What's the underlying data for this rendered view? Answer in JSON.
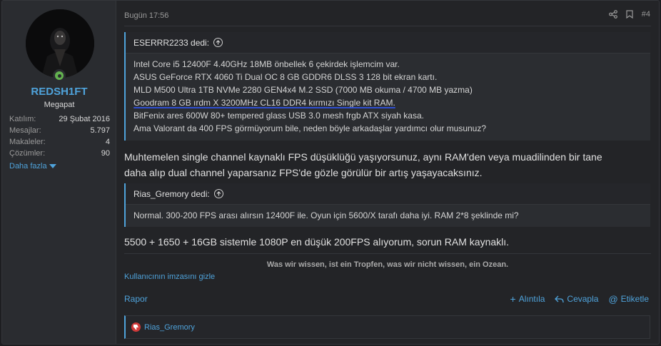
{
  "user": {
    "username": "REDSH1FT",
    "title": "Megapat",
    "stats": [
      {
        "label": "Katılım:",
        "value": "29 Şubat 2016"
      },
      {
        "label": "Mesajlar:",
        "value": "5.797"
      },
      {
        "label": "Makaleler:",
        "value": "4"
      },
      {
        "label": "Çözümler:",
        "value": "90"
      }
    ],
    "more_label": "Daha fazla"
  },
  "post": {
    "date": "Bugün 17:56",
    "number": "#4",
    "quote1": {
      "author": "ESERRR2233 dedi:",
      "lines": [
        "Intel Core i5 12400F 4.40GHz 18MB önbellek 6 çekirdek işlemcim var.",
        "ASUS GeForce RTX 4060 Ti Dual OC 8 GB GDDR6 DLSS 3 128 bit ekran kartı.",
        "MLD M500 Ultra 1TB NVMe 2280 GEN4x4 M.2 SSD (7000 MB okuma / 4700 MB yazma)",
        "Goodram 8 GB ırdm X 3200MHz CL16 DDR4 kırmızı Single kit RAM.",
        "BitFenix ares 600W 80+ tempered glass USB 3.0 mesh frgb ATX siyah kasa.",
        "Ama Valorant da 400 FPS görmüyorum bile, neden böyle arkadaşlar yardımcı olur musunuz?"
      ]
    },
    "reply1_line1": "Muhtemelen single channel kaynaklı FPS düşüklüğü yaşıyorsunuz, aynı RAM'den veya muadilinden bir tane",
    "reply1_line2": "daha alıp dual channel yaparsanız FPS'de gözle görülür bir artış yaşayacaksınız.",
    "quote2": {
      "author": "Rias_Gremory dedi:",
      "text": "Normal. 300-200 FPS arası alırsın 12400F ile. Oyun için 5600/X tarafı daha iyi. RAM 2*8 şeklinde mi?"
    },
    "reply2": "5500 + 1650 + 16GB sistemle 1080P en düşük 200FPS alıyorum, sorun RAM kaynaklı.",
    "signature": "Was wir wissen, ist ein Tropfen, was wir nicht wissen, ein Ozean.",
    "hide_signature": "Kullanıcının imzasını gizle",
    "report": "Rapor",
    "quote_action": "Alıntıla",
    "reply_action": "Cevapla",
    "tag_action": "Etiketle",
    "reaction_user": "Rias_Gremory"
  },
  "colors": {
    "accent": "#4fa3db",
    "online": "#63b14f",
    "reaction": "#d03a3a"
  }
}
